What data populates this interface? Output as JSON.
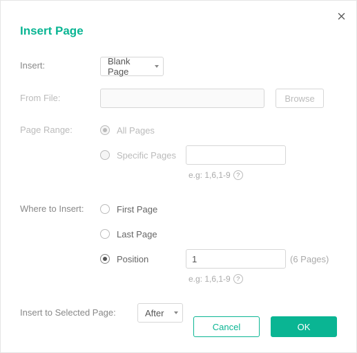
{
  "title": "Insert Page",
  "labels": {
    "insert": "Insert:",
    "fromFile": "From File:",
    "pageRange": "Page Range:",
    "whereToInsert": "Where to Insert:",
    "insertToSelected": "Insert to Selected Page:"
  },
  "insert": {
    "selected": "Blank Page"
  },
  "fromFile": {
    "value": "",
    "browse": "Browse"
  },
  "pageRange": {
    "allPages": "All Pages",
    "specificPages": "Specific Pages",
    "specificValue": "",
    "hint": "e.g: 1,6,1-9"
  },
  "whereToInsert": {
    "firstPage": "First Page",
    "lastPage": "Last Page",
    "position": "Position",
    "positionValue": "1",
    "pagesNote": "(6 Pages)",
    "hint": "e.g: 1,6,1-9"
  },
  "insertToSelected": {
    "selected": "After"
  },
  "buttons": {
    "cancel": "Cancel",
    "ok": "OK"
  }
}
